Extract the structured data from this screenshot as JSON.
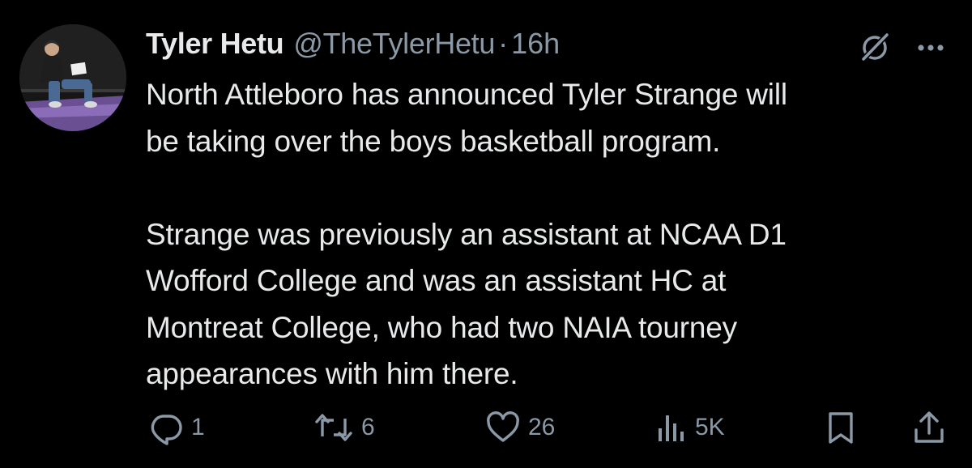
{
  "tweet": {
    "author": {
      "name": "Tyler Hetu",
      "handle": "@TheTylerHetu",
      "separator": "·",
      "timestamp": "16h"
    },
    "text": "North Attleboro has announced Tyler Strange will\nbe taking over the boys basketball program.\n\nStrange was previously an assistant at NCAA D1\nWofford College and was an assistant HC at\nMontreat College, who had two NAIA tourney\nappearances with him there.",
    "actions": {
      "reply_count": "1",
      "retweet_count": "6",
      "like_count": "26",
      "views_count": "5K"
    }
  },
  "icons": {
    "grok": "grok-icon",
    "more": "more-icon",
    "reply": "reply-icon",
    "retweet": "retweet-icon",
    "like": "heart-icon",
    "views": "views-icon",
    "bookmark": "bookmark-icon",
    "share": "share-icon"
  },
  "colors": {
    "background": "#000000",
    "text_primary": "#e7e9ea",
    "text_secondary": "#8b98a5"
  }
}
